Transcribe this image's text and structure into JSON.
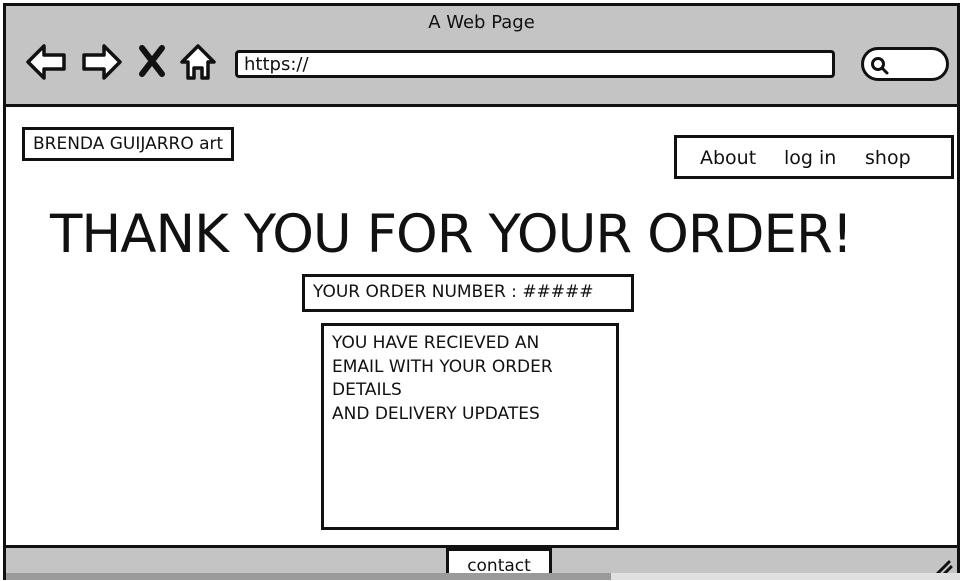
{
  "window": {
    "title": "A Web Page"
  },
  "toolbar": {
    "icons": [
      "back-arrow-icon",
      "forward-arrow-icon",
      "close-x-icon",
      "home-icon"
    ],
    "url": "https://",
    "search_icon": "search-icon"
  },
  "header": {
    "brand": "BRENDA GUIJARRO art",
    "nav": [
      {
        "label": "About"
      },
      {
        "label": "log in"
      },
      {
        "label": "shop"
      }
    ]
  },
  "main": {
    "headline": "THANK YOU FOR YOUR ORDER!",
    "order_number": "YOUR ORDER NUMBER : #####",
    "message_lines": [
      "YOU HAVE RECIEVED AN",
      "EMAIL WITH YOUR ORDER",
      "DETAILS",
      "AND DELIVERY UPDATES"
    ]
  },
  "footer": {
    "contact_label": "contact"
  },
  "colors": {
    "chrome": "#c4c4c4",
    "ink": "#111111",
    "page": "#ffffff"
  }
}
